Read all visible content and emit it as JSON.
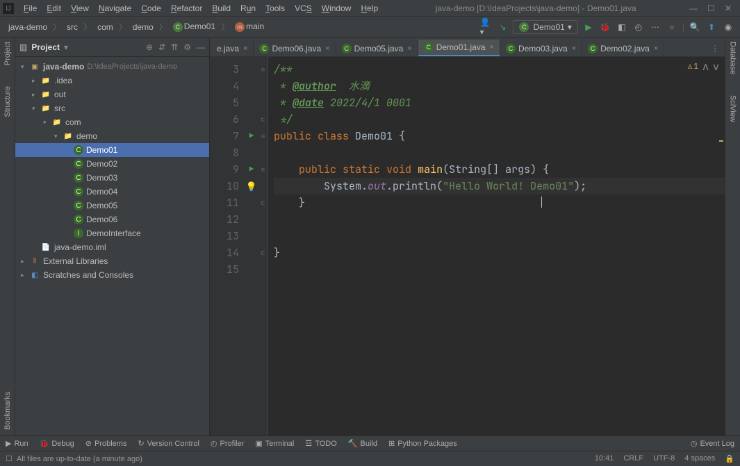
{
  "titlebar": {
    "menus": [
      "File",
      "Edit",
      "View",
      "Navigate",
      "Code",
      "Refactor",
      "Build",
      "Run",
      "Tools",
      "VCS",
      "Window",
      "Help"
    ],
    "title": "java-demo [D:\\IdeaProjects\\java-demo] - Demo01.java"
  },
  "navbar": {
    "crumbs": [
      "java-demo",
      "src",
      "com",
      "demo",
      "Demo01",
      "main"
    ],
    "run_config": "Demo01"
  },
  "left_tools": [
    "Project",
    "Structure",
    "Bookmarks"
  ],
  "right_tools": [
    "Database",
    "SciView"
  ],
  "project_panel": {
    "title": "Project",
    "root": "java-demo",
    "root_path": "D:\\IdeaProjects\\java-demo",
    "idea": ".idea",
    "out": "out",
    "src": "src",
    "com": "com",
    "demo": "demo",
    "classes": [
      "Demo01",
      "Demo02",
      "Demo03",
      "Demo04",
      "Demo05",
      "Demo06"
    ],
    "interface": "DemoInterface",
    "iml": "java-demo.iml",
    "ext_lib": "External Libraries",
    "scratch": "Scratches and Consoles"
  },
  "tabs": [
    {
      "label": "e.java",
      "icon": "",
      "active": false,
      "partial": true
    },
    {
      "label": "Demo06.java",
      "icon": "C",
      "active": false
    },
    {
      "label": "Demo05.java",
      "icon": "C",
      "active": false
    },
    {
      "label": "Demo01.java",
      "icon": "C",
      "active": true
    },
    {
      "label": "Demo03.java",
      "icon": "C",
      "active": false
    },
    {
      "label": "Demo02.java",
      "icon": "C",
      "active": false
    }
  ],
  "editor": {
    "warn_count": "1",
    "line_numbers": [
      "3",
      "4",
      "5",
      "6",
      "7",
      "8",
      "9",
      "10",
      "11",
      "12",
      "13",
      "14",
      "15"
    ],
    "code": {
      "l3": "/**",
      "l4_pre": " * ",
      "l4_tag": "@author",
      "l4_rest": "  水滴",
      "l5_pre": " * ",
      "l5_tag": "@date",
      "l5_rest": " 2022/4/1 0001",
      "l6": " */",
      "l7_kw1": "public ",
      "l7_kw2": "class ",
      "l7_cls": "Demo01 ",
      "l7_br": "{",
      "l9_pad": "    ",
      "l9_kw1": "public ",
      "l9_kw2": "static ",
      "l9_kw3": "void ",
      "l9_m": "main",
      "l9_sig": "(String[] args) {",
      "l10_pad": "        ",
      "l10_sys": "System.",
      "l10_out": "out",
      "l10_dot": ".println(",
      "l10_str": "\"Hello World! Demo01\"",
      "l10_end": ");",
      "l11_pad": "    ",
      "l11_br": "}",
      "l14_br": "}"
    }
  },
  "bottom": {
    "items": [
      "Run",
      "Debug",
      "Problems",
      "Version Control",
      "Profiler",
      "Terminal",
      "TODO",
      "Build",
      "Python Packages"
    ],
    "event_log": "Event Log"
  },
  "status": {
    "msg": "All files are up-to-date (a minute ago)",
    "time": "10:41",
    "le": "CRLF",
    "enc": "UTF-8",
    "indent": "4 spaces"
  }
}
